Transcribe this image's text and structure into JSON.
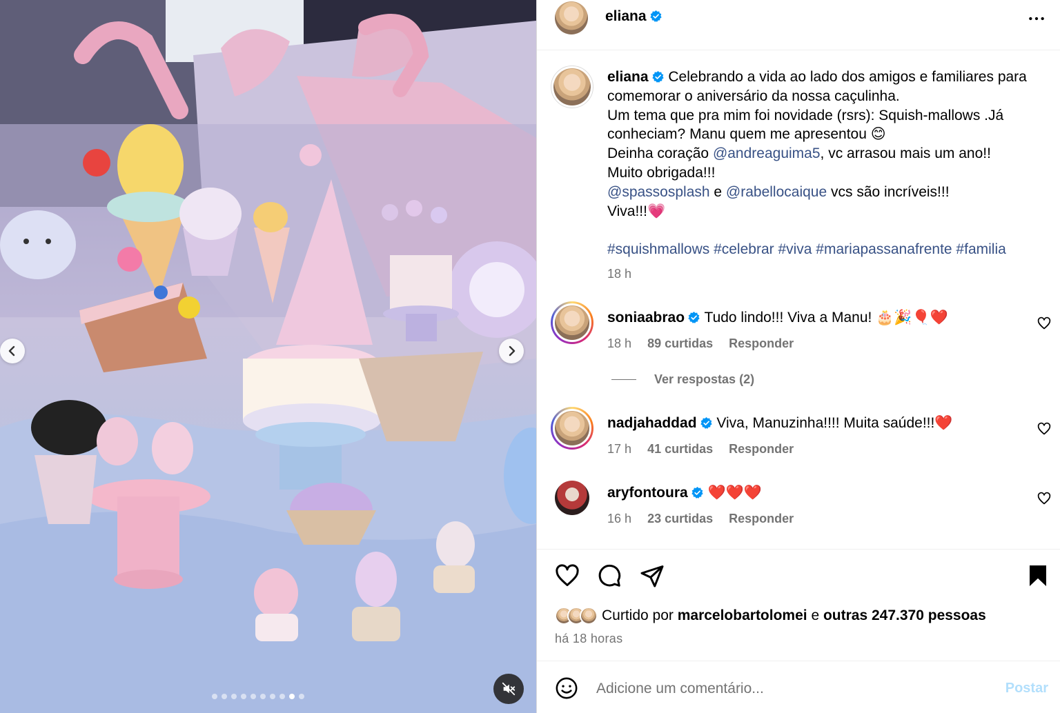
{
  "post": {
    "username": "eliana",
    "caption": {
      "line1": " Celebrando a vida ao lado dos amigos e familiares para comemorar o aniversário da nossa caçulinha.",
      "line2": "Um tema que pra mim foi novidade (rsrs): Squish-mallows .Já conheciam? Manu quem me apresentou 😊",
      "line3_pre": "Deinha coração ",
      "line3_mention": "@andreaguima5",
      "line3_post": ", vc arrasou mais um ano!!",
      "line4": "Muito obrigada!!!",
      "line5_mention1": "@spassosplash",
      "line5_mid": " e ",
      "line5_mention2": "@rabellocaique",
      "line5_post": " vcs são incríveis!!!",
      "line6": "Viva!!!💗",
      "hashtags": "#squishmallows #celebrar #viva #mariapassanafrente #familia",
      "time": "18 h"
    },
    "media": {
      "dots_total": 10,
      "dot_active_index": 8
    }
  },
  "comments": [
    {
      "username": "soniaabrao",
      "verified": true,
      "text": "Tudo lindo!!! Viva a Manu! 🎂🎉🎈❤️",
      "time": "18 h",
      "likes": "89 curtidas",
      "reply": "Responder",
      "view_replies": "Ver respostas (2)"
    },
    {
      "username": "nadjahaddad",
      "verified": true,
      "text": "Viva, Manuzinha!!!! Muita saúde!!!❤️",
      "time": "17 h",
      "likes": "41 curtidas",
      "reply": "Responder"
    },
    {
      "username": "aryfontoura",
      "verified": true,
      "text": "❤️❤️❤️",
      "time": "16 h",
      "likes": "23 curtidas",
      "reply": "Responder"
    }
  ],
  "likes": {
    "prefix": "Curtido por ",
    "user": "marcelobartolomei",
    "mid": " e ",
    "others": "outras 247.370 pessoas",
    "ago": "há 18 horas"
  },
  "composer": {
    "placeholder": "Adicione um comentário...",
    "post_label": "Postar"
  },
  "icons": {
    "verified": "verified-badge-icon",
    "more": "more-options-icon",
    "like": "heart-icon",
    "comment": "comment-bubble-icon",
    "share": "paper-plane-icon",
    "save": "bookmark-icon",
    "emoji": "emoji-icon",
    "mute": "muted-speaker-icon"
  },
  "colors": {
    "verified_blue": "#0095f6",
    "link": "#385185",
    "secondary_text": "#737373",
    "post_disabled": "#b2dffc"
  }
}
